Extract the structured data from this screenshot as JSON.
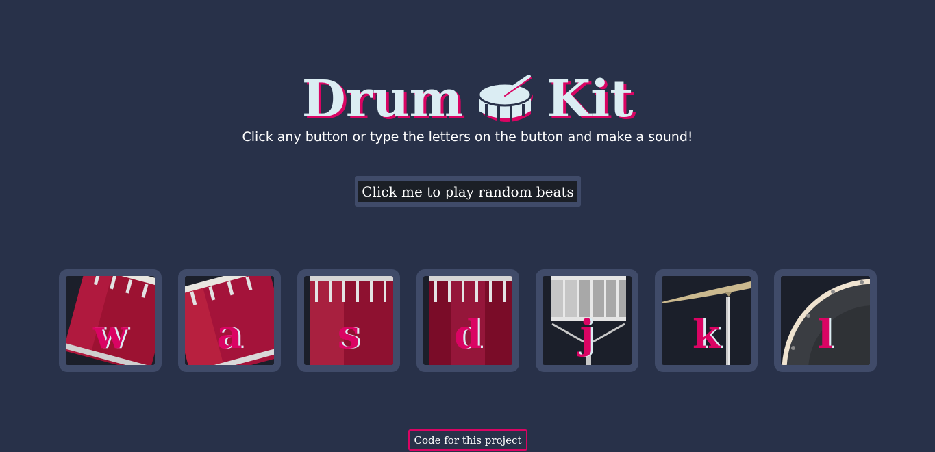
{
  "header": {
    "title_left": "Drum",
    "title_right": "Kit",
    "title_icon": "drum-icon",
    "subtitle": "Click any button or type the letters on the button and make a sound!"
  },
  "random_button": {
    "label": "Click me to play random beats"
  },
  "pads": [
    {
      "key": "w",
      "instrument": "tom-1"
    },
    {
      "key": "a",
      "instrument": "tom-2"
    },
    {
      "key": "s",
      "instrument": "tom-3"
    },
    {
      "key": "d",
      "instrument": "tom-4"
    },
    {
      "key": "j",
      "instrument": "snare"
    },
    {
      "key": "k",
      "instrument": "crash"
    },
    {
      "key": "l",
      "instrument": "kick-bass"
    }
  ],
  "footer": {
    "link_label": "Code for this project"
  },
  "colors": {
    "background": "#283149",
    "pad_frame": "#404b69",
    "accent": "#da0463",
    "title": "#dbedf3"
  }
}
